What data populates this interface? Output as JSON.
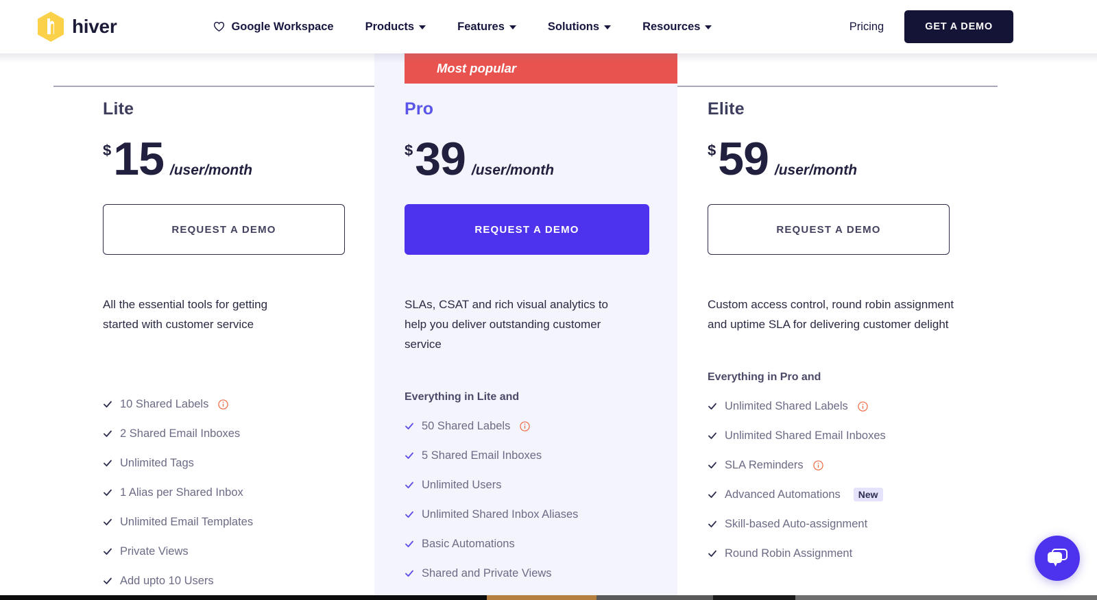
{
  "header": {
    "logo_text": "hiver",
    "logo_icon": "hiver-hexagon-logo",
    "nav": [
      {
        "label": "Google Workspace",
        "icon": "heart-icon",
        "has_caret": false
      },
      {
        "label": "Products",
        "has_caret": true
      },
      {
        "label": "Features",
        "has_caret": true
      },
      {
        "label": "Solutions",
        "has_caret": true
      },
      {
        "label": "Resources",
        "has_caret": true
      }
    ],
    "pricing_link": "Pricing",
    "demo_button": "GET A DEMO"
  },
  "pricing": {
    "most_popular_label": "Most popular",
    "plans": [
      {
        "name": "Lite",
        "currency": "$",
        "amount": "15",
        "period": "/user/month",
        "cta": "REQUEST A DEMO",
        "blurb": "All the essential tools for getting started with customer service",
        "features_heading": "",
        "features": [
          {
            "label": "10 Shared Labels",
            "info": true
          },
          {
            "label": "2 Shared Email Inboxes",
            "info": false
          },
          {
            "label": "Unlimited Tags",
            "info": false
          },
          {
            "label": "1 Alias per Shared Inbox",
            "info": false
          },
          {
            "label": "Unlimited Email Templates",
            "info": false
          },
          {
            "label": "Private Views",
            "info": false
          },
          {
            "label": "Add upto 10 Users",
            "info": false
          }
        ]
      },
      {
        "name": "Pro",
        "currency": "$",
        "amount": "39",
        "period": "/user/month",
        "cta": "REQUEST A DEMO",
        "blurb": "SLAs, CSAT and rich visual analytics to help you deliver outstanding customer service",
        "features_heading": "Everything in Lite and",
        "features": [
          {
            "label": "50 Shared Labels",
            "info": true
          },
          {
            "label": "5 Shared Email Inboxes",
            "info": false
          },
          {
            "label": "Unlimited Users",
            "info": false
          },
          {
            "label": "Unlimited Shared Inbox Aliases",
            "info": false
          },
          {
            "label": "Basic Automations",
            "info": false
          },
          {
            "label": "Shared and Private Views",
            "info": false
          }
        ]
      },
      {
        "name": "Elite",
        "currency": "$",
        "amount": "59",
        "period": "/user/month",
        "cta": "REQUEST A DEMO",
        "blurb": "Custom access control, round robin assignment and uptime SLA for delivering customer delight",
        "features_heading": "Everything in Pro and",
        "features": [
          {
            "label": "Unlimited Shared Labels",
            "info": true
          },
          {
            "label": "Unlimited Shared Email Inboxes",
            "info": false
          },
          {
            "label": "SLA Reminders",
            "info": true
          },
          {
            "label": "Advanced Automations",
            "info": false,
            "badge": "New"
          },
          {
            "label": "Skill-based Auto-assignment",
            "info": false
          },
          {
            "label": "Round Robin Assignment",
            "info": false
          }
        ]
      }
    ]
  },
  "chat": {
    "icon": "chat-bubble-icon"
  },
  "colors": {
    "accent_purple": "#4e33ee",
    "pro_name": "#5a55e8",
    "most_popular_red": "#e8534f",
    "logo_yellow": "#fcd14a",
    "dark_navy": "#141437",
    "info_orange": "#ef6b43",
    "badge_bg": "#e4e3fb",
    "pro_column_bg": "#f4f4fd"
  }
}
